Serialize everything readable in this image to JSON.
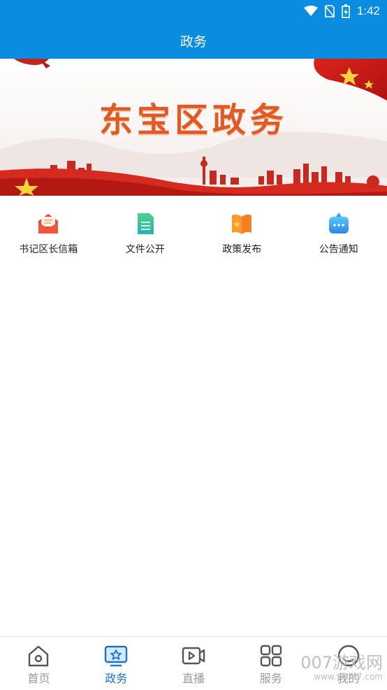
{
  "status_bar": {
    "time": "1:42"
  },
  "app_bar": {
    "title": "政务"
  },
  "banner": {
    "title": "东宝区政务"
  },
  "shortcuts": [
    {
      "label": "书记区长信箱",
      "icon": "mail-icon",
      "color": "#f0563c"
    },
    {
      "label": "文件公开",
      "icon": "document-icon",
      "color": "#35c29a"
    },
    {
      "label": "政策发布",
      "icon": "book-icon",
      "color": "#f7902c"
    },
    {
      "label": "公告通知",
      "icon": "chat-bubble-icon",
      "color": "#2f9cf0"
    }
  ],
  "bottom_nav": [
    {
      "label": "首页",
      "icon": "home-icon",
      "active": false
    },
    {
      "label": "政务",
      "icon": "government-icon",
      "active": true
    },
    {
      "label": "直播",
      "icon": "live-video-icon",
      "active": false
    },
    {
      "label": "服务",
      "icon": "grid-icon",
      "active": false
    },
    {
      "label": "我的",
      "icon": "profile-icon",
      "active": false
    }
  ],
  "watermark": {
    "text": "007游戏网",
    "url": "www.yx007.com"
  },
  "colors": {
    "primary": "#0a8de0",
    "nav_active": "#1a73c9",
    "nav_inactive": "#999999"
  }
}
